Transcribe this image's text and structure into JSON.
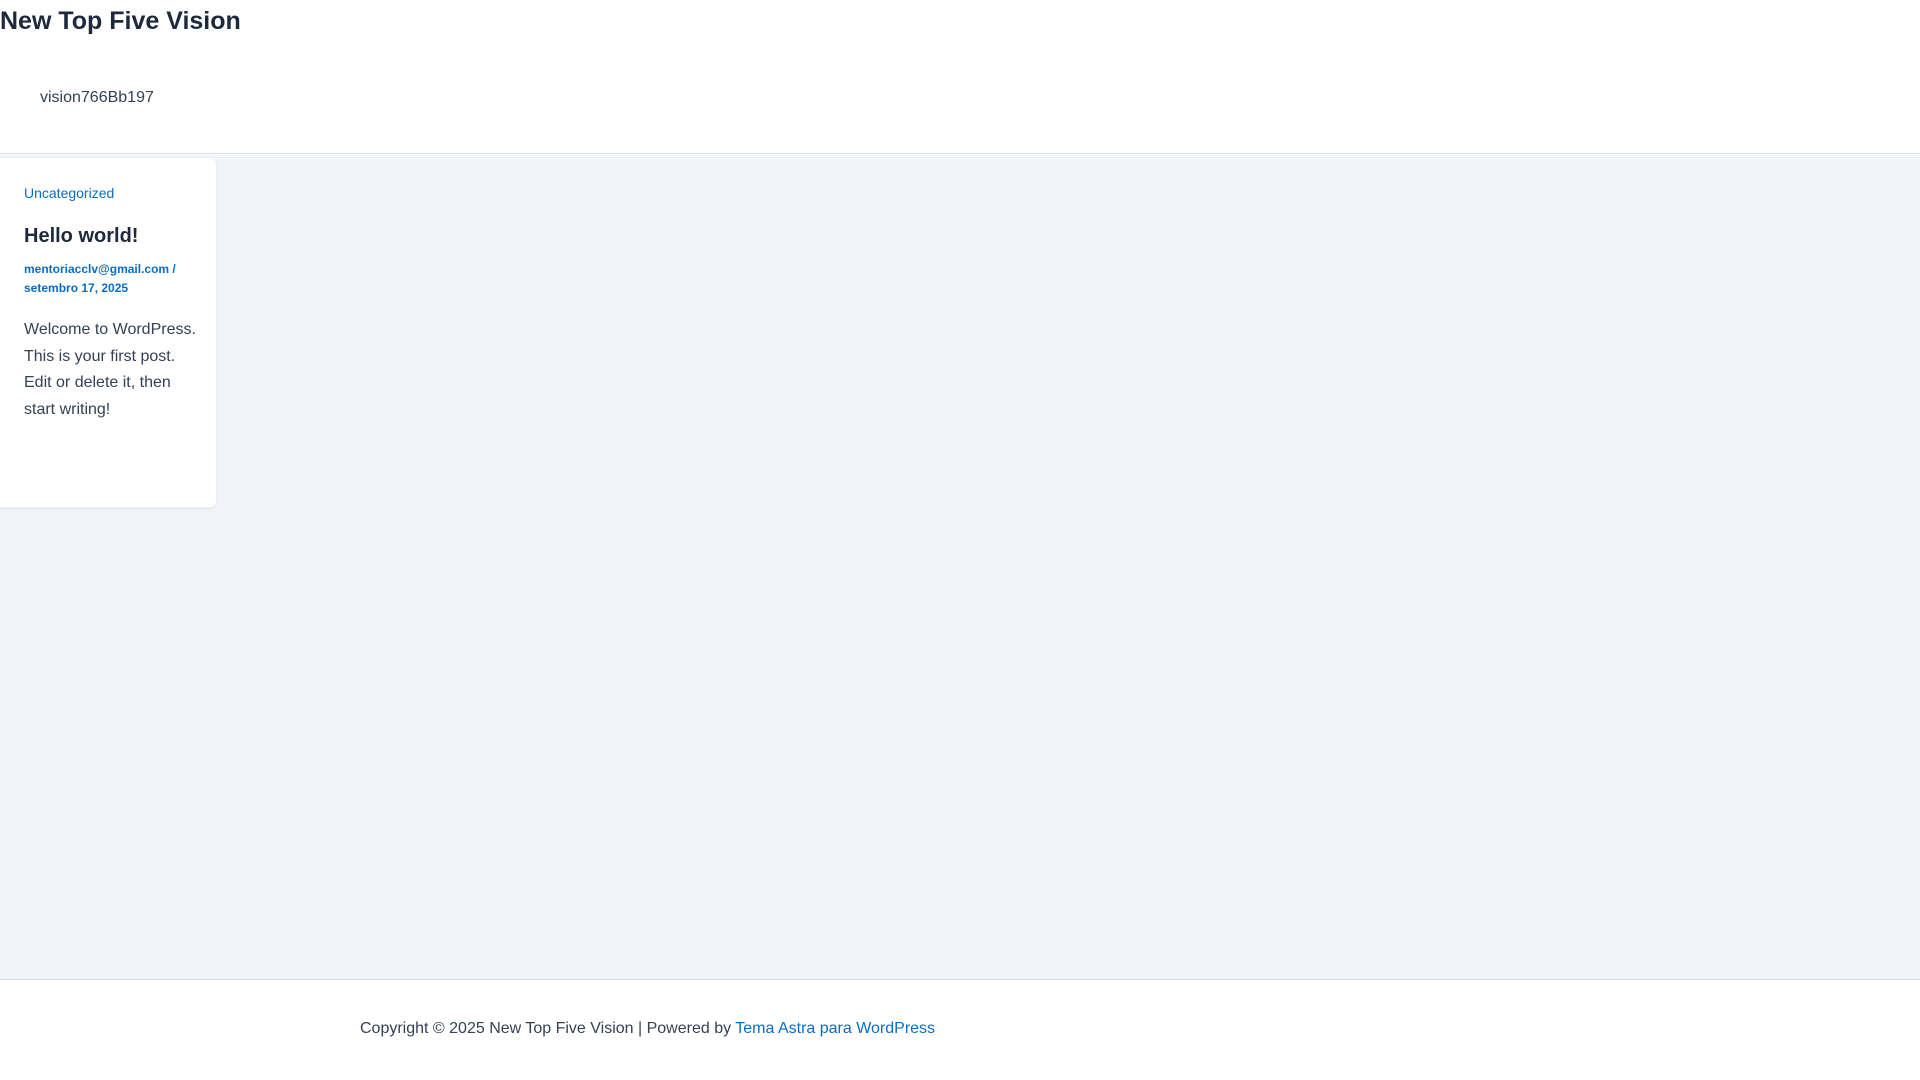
{
  "header": {
    "site_title": "New Top Five Vision",
    "nav_item": "vision766Bb197"
  },
  "post": {
    "category": "Uncategorized",
    "title": "Hello world!",
    "author": "mentoriacclv@gmail.com",
    "separator": " / ",
    "date": "setembro 17, 2025",
    "excerpt": "Welcome to WordPress. This is your first post. Edit or delete it, then start writing!"
  },
  "footer": {
    "copyright_text": "Copyright © 2025 New Top Five Vision | Powered by ",
    "theme_link_text": "Tema Astra para WordPress"
  },
  "colors": {
    "accent": "#0a6dc4",
    "heading": "#1e293b",
    "body_text": "#334155",
    "content_background": "#f0f4f8"
  }
}
